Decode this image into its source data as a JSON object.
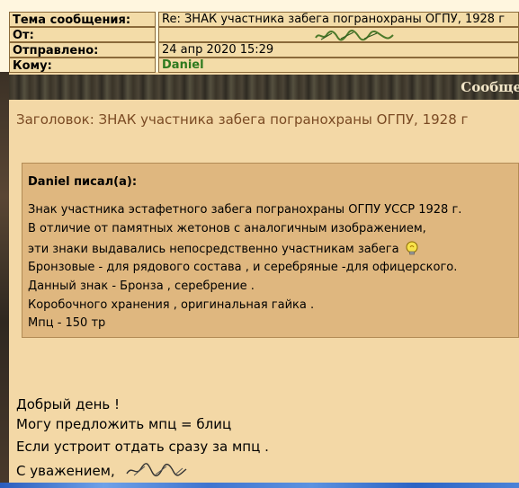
{
  "header": {
    "subject_label": "Тема сообщения:",
    "subject_value": "Re: ЗНАК участника забега погранохраны ОГПУ, 1928 г",
    "from_label": "От:",
    "sent_label": "Отправлено:",
    "sent_value": "24 апр 2020 15:29",
    "to_label": "Кому:",
    "to_value": "Daniel"
  },
  "banner": {
    "title": "Сообщен"
  },
  "message": {
    "subject_line": "Заголовок: ЗНАК участника забега погранохраны ОГПУ, 1928 г",
    "quote": {
      "author": "Daniel писал(а):",
      "lines": [
        "Знак участника эстафетного забега погранохраны ОГПУ УССР 1928 г.",
        "В отличие от памятных жетонов с аналогичным изображением,",
        "эти знаки выдавались непосредственно участникам забега",
        "Бронзовые - для рядового состава , и серебряные -для офицерского.",
        "Данный знак - Бронза , серебрение .",
        "Коробочного хранения , оригинальная гайка .",
        "Мпц - 150 тр"
      ]
    },
    "reply_lines": [
      "Добрый день !",
      "Могу предложить мпц = блиц",
      "Если устроит отдать сразу за мпц .",
      "С уважением,"
    ]
  },
  "colors": {
    "page_bg": "#f3d8a6",
    "quote_bg": "#dfb77f",
    "subject_text": "#7a4a23",
    "username": "#2d7a1e"
  },
  "icons": [
    "lightbulb-icon",
    "signature-scribble"
  ]
}
